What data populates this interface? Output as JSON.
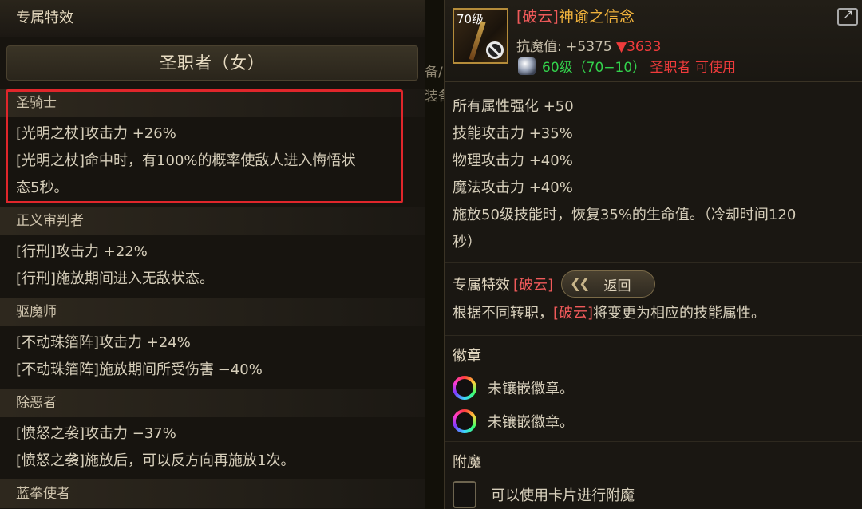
{
  "left_panel": {
    "title": "专属特效",
    "class_name": "圣职者（女）",
    "sections": [
      {
        "name": "圣骑士",
        "lines": [
          "[光明之杖]攻击力 +26%",
          "[光明之杖]命中时，有100%的概率使敌人进入悔悟状",
          "态5秒。"
        ]
      },
      {
        "name": "正义审判者",
        "lines": [
          "[行刑]攻击力 +22%",
          "[行刑]施放期间进入无敌状态。"
        ]
      },
      {
        "name": "驱魔师",
        "lines": [
          "[不动珠箔阵]攻击力 +24%",
          "[不动珠箔阵]施放期间所受伤害 −40%"
        ]
      },
      {
        "name": "除恶者",
        "lines": [
          "[愤怒之袭]攻击力 −37%",
          "[愤怒之袭]施放后，可以反方向再施放1次。"
        ]
      },
      {
        "name": "蓝拳使者",
        "lines": []
      }
    ]
  },
  "middle_fragments": {
    "top": "备/",
    "second": "装备"
  },
  "item": {
    "icon_level": "70级",
    "name_tag": "[破云]",
    "name_rest": "神谕之信念",
    "resist_label": "抗魔值: +5375",
    "resist_down": "▼3633",
    "level_green": "60级（70−10）",
    "level_red": "圣职者 可使用",
    "stats": [
      "所有属性强化 +50",
      "技能攻击力 +35%",
      "物理攻击力 +40%",
      "魔法攻击力 +40%",
      "施放50级技能时，恢复35%的生命值。（冷却时间120",
      "秒）"
    ],
    "exclusive_label": "专属特效",
    "exclusive_tag": "[破云]",
    "back_chevrons": "❮❮",
    "back_label": "返回",
    "exclusive_desc_pre": "根据不同转职，",
    "exclusive_desc_tag": "[破云]",
    "exclusive_desc_post": "将变更为相应的技能属性。",
    "emblem_title": "徽章",
    "emblems": [
      "未镶嵌徽章。",
      "未镶嵌徽章。"
    ],
    "enchant_title": "附魔",
    "enchant_text": "可以使用卡片进行附魔"
  },
  "colors": {
    "highlight_box": "#e0262b",
    "tag_red": "#f05a5a",
    "name_gold": "#f0b23c",
    "level_green": "#33d24c",
    "warn_red": "#ef3b3b"
  },
  "icons": [
    "ban-icon",
    "share-icon",
    "gem-icon",
    "emblem-slot-icon",
    "card-slot-icon",
    "double-chevron-left-icon"
  ]
}
